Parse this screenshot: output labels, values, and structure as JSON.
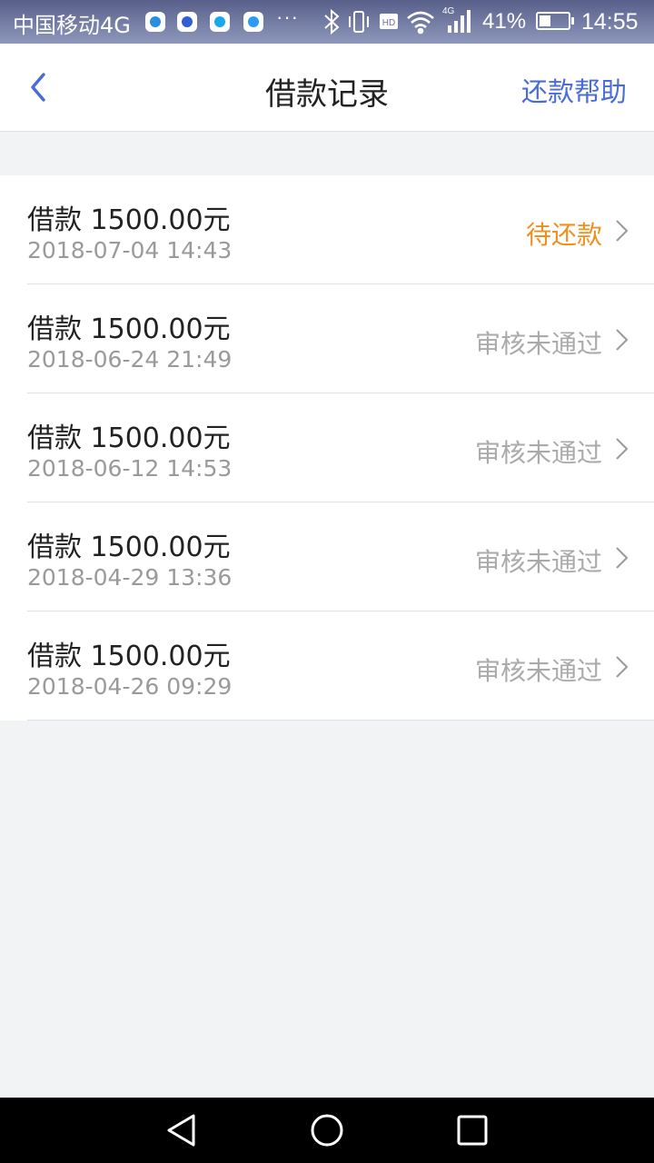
{
  "status_bar": {
    "carrier": "中国移动4G",
    "network_badge": "4G",
    "hd_badge": "HD",
    "battery_level": 0.41,
    "battery": "41%",
    "time": "14:55",
    "more": "···",
    "icons": [
      "app-edge-icon",
      "app-baidu-icon",
      "app-qq-icon",
      "app-message-icon",
      "bluetooth-icon",
      "vibrate-icon",
      "hd-icon",
      "wifi-icon",
      "signal-icon",
      "battery-icon"
    ]
  },
  "header": {
    "title": "借款记录",
    "help_link": "还款帮助",
    "back_icon": "chevron-left-icon"
  },
  "colors": {
    "accent": "#4a6cd8",
    "pending": "#ef8f1e",
    "muted": "#aaaaaa",
    "page_bg": "#f2f3f5"
  },
  "records": [
    {
      "amount": "借款 1500.00元",
      "time": "2018-07-04 14:43",
      "status": "待还款"
    },
    {
      "amount": "借款 1500.00元",
      "time": "2018-06-24 21:49",
      "status": "审核未通过"
    },
    {
      "amount": "借款 1500.00元",
      "time": "2018-06-12 14:53",
      "status": "审核未通过"
    },
    {
      "amount": "借款 1500.00元",
      "time": "2018-04-29 13:36",
      "status": "审核未通过"
    },
    {
      "amount": "借款 1500.00元",
      "time": "2018-04-26 09:29",
      "status": "审核未通过"
    }
  ],
  "nav_bar": {
    "icons": [
      "back-triangle-icon",
      "home-circle-icon",
      "recents-square-icon"
    ]
  }
}
